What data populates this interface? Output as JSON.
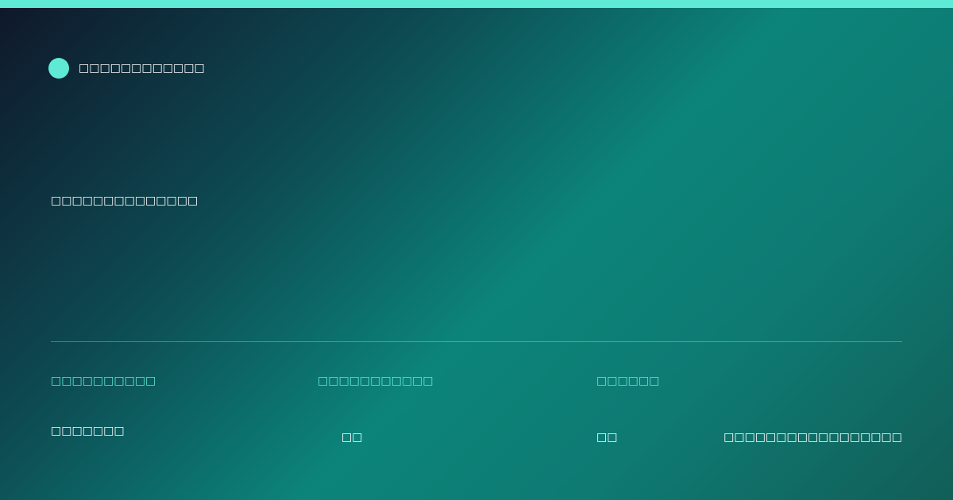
{
  "colors": {
    "accent": "#5eead4",
    "background_dark": "#0f172a",
    "background_teal": "#0c847a",
    "text": "#ffffff"
  },
  "brand": {
    "icon": "accent-dot-icon",
    "name": "□□□□□□□□□□□□"
  },
  "headline": "□□□□□□□□□□□□□□",
  "info": {
    "col1": {
      "label": "□□□□□□□□□□",
      "value": "□□□□□□□"
    },
    "col2": {
      "label": "□□□□□□□□□□□",
      "value": "□□"
    },
    "col3": {
      "label": "□□□□□□",
      "value": "□□"
    },
    "col4": {
      "value": "□□□□□□□□□□□□□□□□□"
    }
  }
}
